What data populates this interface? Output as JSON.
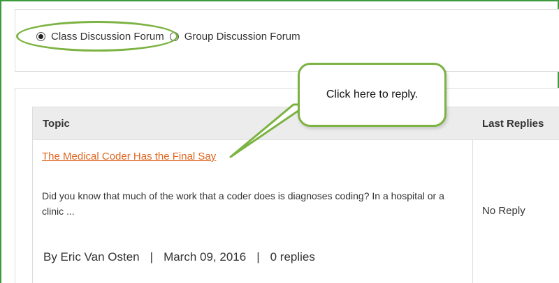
{
  "forum_selector": {
    "options": [
      {
        "label": "Class Discussion Forum",
        "selected": true
      },
      {
        "label": "Group Discussion Forum",
        "selected": false
      }
    ]
  },
  "callout": {
    "text": "Click here to reply."
  },
  "table": {
    "headers": {
      "topic": "Topic",
      "last_replies": "Last Replies"
    },
    "rows": [
      {
        "title": "The Medical Coder Has the Final Say",
        "excerpt": "Did you know that much of the work that a coder does is diagnoses coding? In a hospital or a clinic ...",
        "author": "By Eric Van Osten",
        "date": "March 09, 2016",
        "replies": "0 replies",
        "separator": "|",
        "last_reply": "No Reply"
      }
    ]
  },
  "colors": {
    "frame_border": "#3c9a3c",
    "highlight": "#7cb342",
    "link": "#e06620",
    "header_bg": "#ececec"
  }
}
